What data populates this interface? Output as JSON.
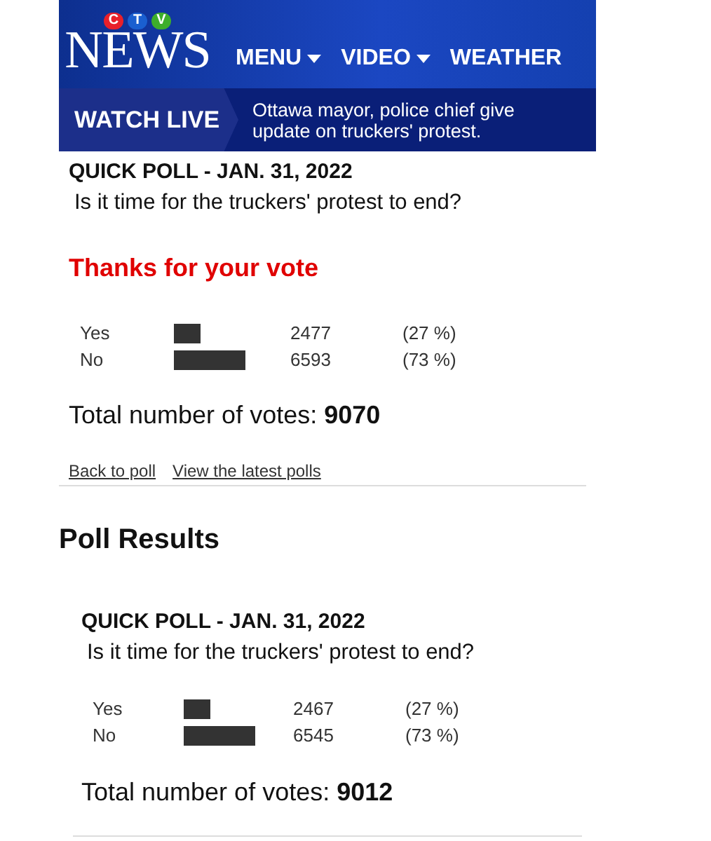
{
  "header": {
    "logo": {
      "letters": [
        {
          "text": "C",
          "color": "#e8202a"
        },
        {
          "text": "T",
          "color": "#1a5fd0"
        },
        {
          "text": "V",
          "color": "#3dae2b"
        }
      ],
      "word": "NEWS"
    },
    "nav": [
      {
        "label": "MENU",
        "dropdown": true
      },
      {
        "label": "VIDEO",
        "dropdown": true
      },
      {
        "label": "WEATHER",
        "dropdown": false
      }
    ],
    "watch_live": "WATCH LIVE",
    "headline": "Ottawa mayor, police chief give update on truckers' protest."
  },
  "poll": {
    "title": "QUICK POLL - JAN. 31, 2022",
    "question": "Is it time for the truckers' protest to end?",
    "message": "Thanks for your vote",
    "results": [
      {
        "option": "Yes",
        "votes": "2477",
        "percent": "(27 %)"
      },
      {
        "option": "No",
        "votes": "6593",
        "percent": "(73 %)"
      }
    ],
    "total_label": "Total number of votes:",
    "total": "9070",
    "links": [
      "Back to poll",
      "View the latest polls"
    ]
  },
  "results_heading": "Poll Results",
  "results_poll": {
    "title": "QUICK POLL - JAN. 31, 2022",
    "question": "Is it time for the truckers' protest to end?",
    "results": [
      {
        "option": "Yes",
        "votes": "2467",
        "percent": "(27 %)"
      },
      {
        "option": "No",
        "votes": "6545",
        "percent": "(73 %)"
      }
    ],
    "total_label": "Total number of votes:",
    "total": "9012"
  }
}
